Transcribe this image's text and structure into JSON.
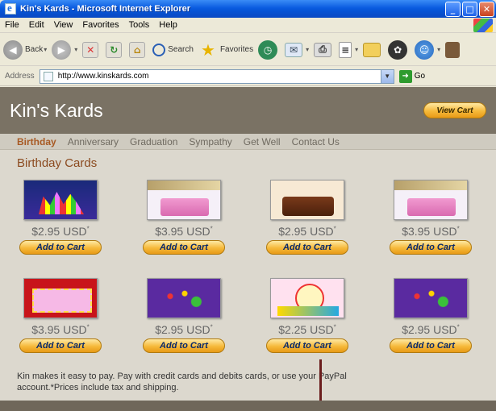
{
  "window": {
    "title": "Kin's Kards - Microsoft Internet Explorer",
    "min_label": "_",
    "max_label": "□",
    "close_label": "✕"
  },
  "menu": [
    "File",
    "Edit",
    "View",
    "Favorites",
    "Tools",
    "Help"
  ],
  "toolbar": {
    "back_label": "Back",
    "search_label": "Search",
    "favorites_label": "Favorites"
  },
  "address": {
    "label": "Address",
    "url": "http://www.kinskards.com",
    "go_label": "Go"
  },
  "site": {
    "title": "Kin's Kards",
    "view_cart_label": "View Cart",
    "nav": [
      "Birthday",
      "Anniversary",
      "Graduation",
      "Sympathy",
      "Get Well",
      "Contact Us"
    ],
    "active_nav": "Birthday",
    "section_title": "Birthday Cards",
    "add_to_cart_label": "Add to Cart",
    "cards": [
      {
        "price": "$2.95 USD",
        "art": "party"
      },
      {
        "price": "$3.95 USD",
        "art": "cake"
      },
      {
        "price": "$2.95 USD",
        "art": "choc"
      },
      {
        "price": "$3.95 USD",
        "art": "cake"
      },
      {
        "price": "$3.95 USD",
        "art": "red"
      },
      {
        "price": "$2.95 USD",
        "art": "purple"
      },
      {
        "price": "$2.25 USD",
        "art": "clown"
      },
      {
        "price": "$2.95 USD",
        "art": "purple"
      }
    ],
    "price_mark": "*",
    "footer": "Kin makes it easy to pay. Pay with credit cards and debits cards, or use your PayPal account.*Prices include tax and shipping."
  },
  "colors": {
    "header_bg": "#7a7264",
    "accent": "#a85a24",
    "button": "#f6b93a"
  }
}
